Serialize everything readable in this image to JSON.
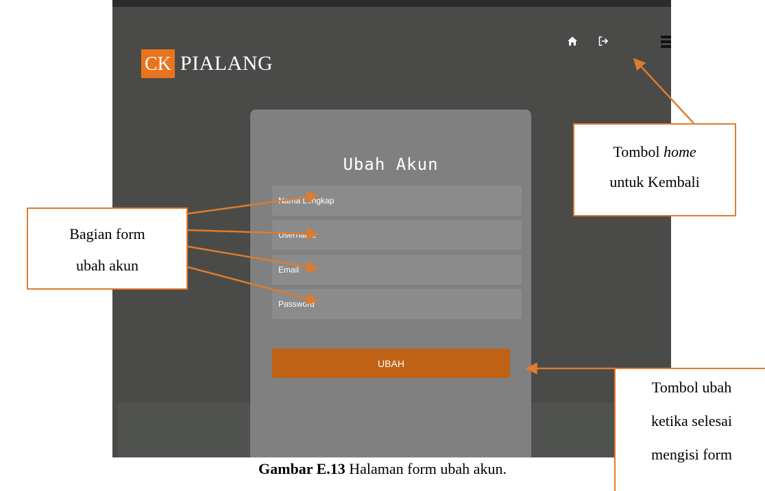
{
  "app": {
    "logo_mark": "CK",
    "brand_name": "PIALANG",
    "nav_icons": [
      "home-icon",
      "logout-icon",
      "menu-icon"
    ]
  },
  "form": {
    "title": "Ubah Akun",
    "fields": {
      "full_name_placeholder": "Nama Lengkap",
      "username_placeholder": "Username",
      "email_placeholder": "Email",
      "password_placeholder": "Password"
    },
    "submit_label": "UBAH"
  },
  "annotations": {
    "home": {
      "line1": "Tombol ",
      "line1_em": "home",
      "line2": "untuk Kembali"
    },
    "form_section": {
      "line1": "Bagian form",
      "line2": "ubah akun"
    },
    "submit": {
      "line1": "Tombol ubah",
      "line2": "ketika selesai",
      "line3": "mengisi form"
    }
  },
  "caption": {
    "label": "Gambar E.13",
    "text": " Halaman form ubah akun."
  },
  "colors": {
    "brand_orange": "#e8741e",
    "button_orange": "#c06215",
    "callout_border": "#e07b2d",
    "background": "#4a4b49",
    "card": "#808080"
  }
}
